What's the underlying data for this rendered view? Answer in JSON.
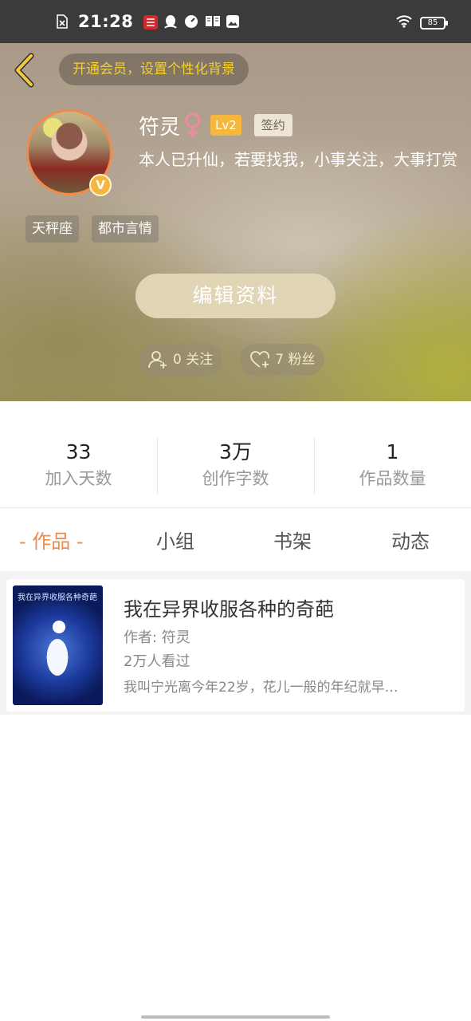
{
  "status_bar": {
    "time": "21:28",
    "battery": "85",
    "icons": [
      "sim-missing-icon",
      "app-notification-icon",
      "qq-icon",
      "speed-icon",
      "book-icon",
      "image-icon",
      "wifi-icon",
      "battery-icon"
    ]
  },
  "header": {
    "vip_banner": "开通会员，设置个性化背景",
    "name": "符灵",
    "level": "Lv2",
    "signed_badge": "签约",
    "bio": "本人已升仙，若要找我，小事关注，大事打赏",
    "tags": [
      "天秤座",
      "都市言情"
    ],
    "edit_button": "编辑资料",
    "follow_label": "0 关注",
    "fans_label": "7 粉丝",
    "vip_badge": "V"
  },
  "stats": [
    {
      "value": "33",
      "label": "加入天数"
    },
    {
      "value": "3万",
      "label": "创作字数"
    },
    {
      "value": "1",
      "label": "作品数量"
    }
  ],
  "tabs": [
    "- 作品 -",
    "小组",
    "书架",
    "动态"
  ],
  "active_tab": "- 作品 -",
  "works": [
    {
      "title": "我在异界收服各种的奇葩",
      "author": "作者: 符灵",
      "views": "2万人看过",
      "description": "我叫宁光离今年22岁，花儿一般的年纪就早…",
      "cover_text": "我在异界收服各种奇葩"
    }
  ],
  "colors": {
    "accent": "#f0894f",
    "vip_yellow": "#f7cf35",
    "level_badge": "#f5b73c"
  }
}
